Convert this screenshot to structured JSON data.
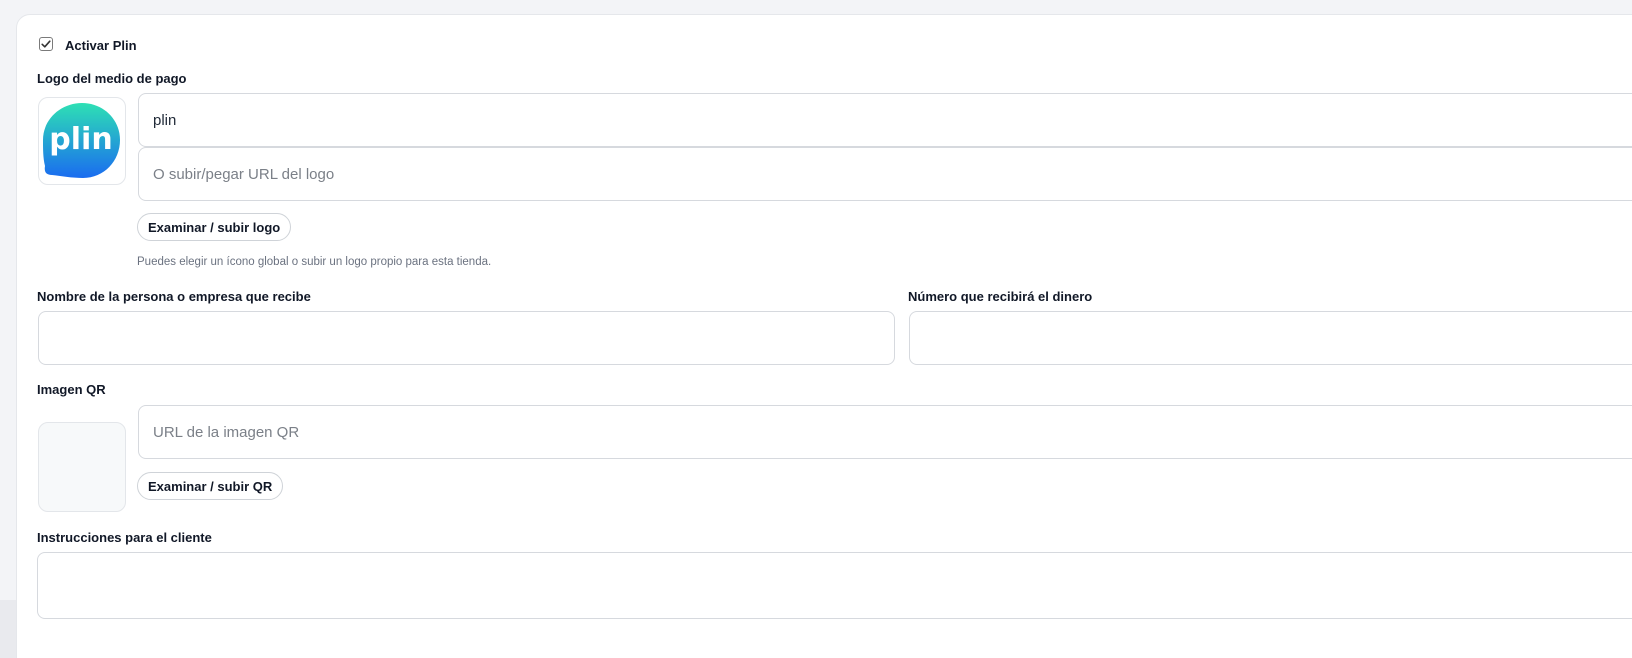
{
  "activation": {
    "checked": true,
    "label": "Activar Plin"
  },
  "logo_section": {
    "label": "Logo del medio de pago",
    "logo_text": "plin",
    "logo_colors": {
      "gradient_start": "#2ee0b4",
      "gradient_end": "#1a6cf0",
      "text": "#ffffff"
    },
    "name_value": "plin",
    "url_placeholder": "O subir/pegar URL del logo",
    "upload_button": "Examinar / subir logo",
    "hint": "Puedes elegir un ícono global o subir un logo propio para esta tienda."
  },
  "recipient": {
    "name_label": "Nombre de la persona o empresa que recibe",
    "name_value": "",
    "number_label": "Número que recibirá el dinero",
    "number_value": ""
  },
  "qr_section": {
    "label": "Imagen QR",
    "url_placeholder": "URL de la imagen QR",
    "upload_button": "Examinar / subir QR"
  },
  "instructions": {
    "label": "Instrucciones para el cliente",
    "value": ""
  }
}
